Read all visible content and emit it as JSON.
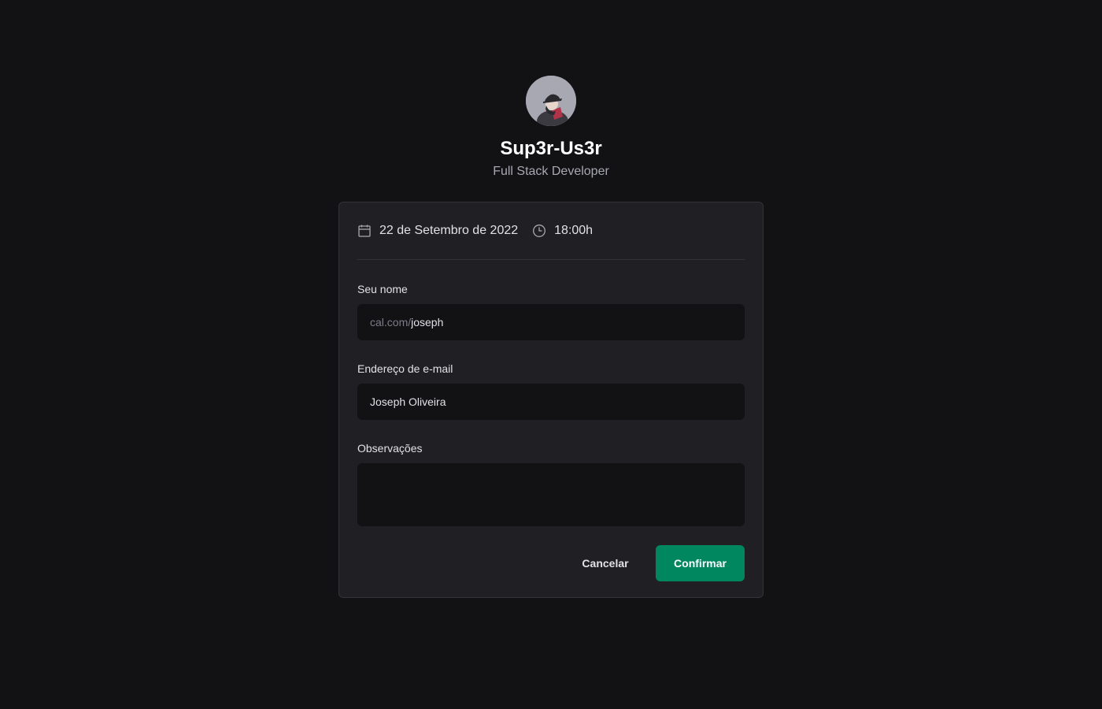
{
  "profile": {
    "name": "Sup3r-Us3r",
    "role": "Full Stack Developer",
    "avatar_icon": "user-avatar"
  },
  "schedule": {
    "date_icon": "calendar-icon",
    "date": "22 de Setembro de 2022",
    "time_icon": "clock-icon",
    "time": "18:00h"
  },
  "form": {
    "name_label": "Seu nome",
    "name_prefix": "cal.com/",
    "name_value": "joseph",
    "email_label": "Endereço de e-mail",
    "email_value": "Joseph Oliveira",
    "notes_label": "Observações",
    "notes_value": ""
  },
  "actions": {
    "cancel_label": "Cancelar",
    "confirm_label": "Confirmar"
  },
  "colors": {
    "background": "#121214",
    "card": "#202024",
    "input": "#121214",
    "accent": "#00875f",
    "text": "#e1e1e6",
    "muted": "#a8a8b3"
  }
}
